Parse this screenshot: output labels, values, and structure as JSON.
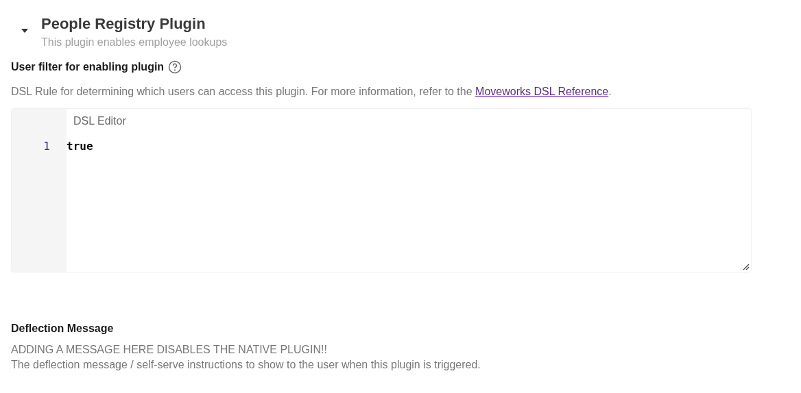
{
  "plugin": {
    "title": "People Registry Plugin",
    "subtitle": "This plugin enables employee lookups",
    "expanded": true
  },
  "user_filter": {
    "label": "User filter for enabling plugin",
    "description": "DSL Rule for determining which users can access this plugin. For more information, refer to the ",
    "link": "Moveworks DSL Reference",
    "description_end": ".",
    "editor": {
      "label": "DSL Editor",
      "lines": [
        {
          "number": "1",
          "code": "true"
        }
      ]
    }
  },
  "deflection": {
    "label": "Deflection Message",
    "lines": [
      "ADDING A MESSAGE HERE DISABLES THE NATIVE PLUGIN!!",
      "The deflection message / self-serve instructions to show to the user when this plugin is triggered."
    ]
  }
}
